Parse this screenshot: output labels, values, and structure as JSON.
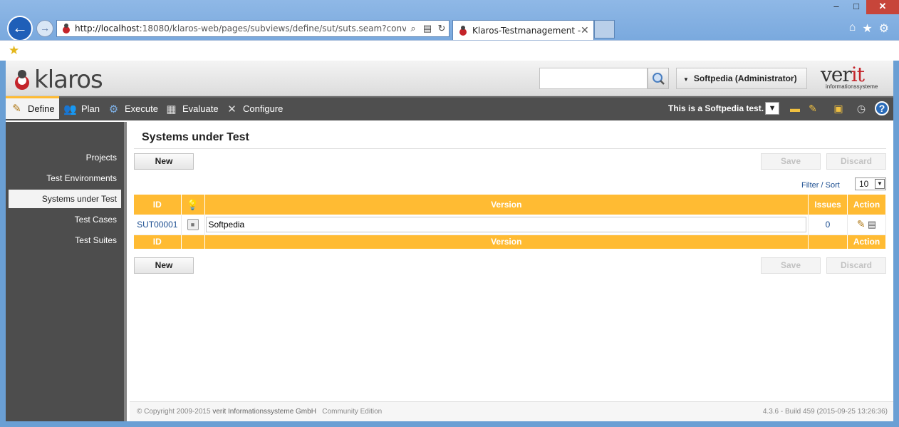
{
  "browser": {
    "url_host": "http://localhost",
    "url_rest": ":18080/klaros-web/pages/subviews/define/sut/suts.seam?conversation",
    "tab_title": "Klaros-Testmanagement - ...",
    "tab_close": "✕"
  },
  "header": {
    "logo_text": "klaros",
    "search_placeholder": "",
    "user_label": "Softpedia (Administrator)",
    "vendor_logo": "verit",
    "vendor_sub": "informationssysteme"
  },
  "nav": {
    "items": [
      {
        "label": "Define",
        "icon": "define-icon"
      },
      {
        "label": "Plan",
        "icon": "plan-icon"
      },
      {
        "label": "Execute",
        "icon": "execute-icon"
      },
      {
        "label": "Evaluate",
        "icon": "evaluate-icon"
      },
      {
        "label": "Configure",
        "icon": "configure-icon"
      }
    ],
    "project": "This is a Softpedia test."
  },
  "sidebar": {
    "items": [
      {
        "label": "Projects"
      },
      {
        "label": "Test Environments"
      },
      {
        "label": "Systems under Test"
      },
      {
        "label": "Test Cases"
      },
      {
        "label": "Test Suites"
      }
    ]
  },
  "main": {
    "title": "Systems under Test",
    "new_label": "New",
    "save_label": "Save",
    "discard_label": "Discard",
    "filter_label": "Filter / Sort",
    "page_size": "10",
    "columns": {
      "id": "ID",
      "version": "Version",
      "issues": "Issues",
      "action": "Action"
    },
    "rows": [
      {
        "id": "SUT00001",
        "version": "Softpedia",
        "issues": "0"
      }
    ]
  },
  "footer": {
    "copyright": "© Copyright 2009-2015",
    "company": "verit Informationssysteme GmbH",
    "edition": "Community Edition",
    "build": "4.3.6 - Build 459 (2015-09-25 13:26:36)"
  },
  "colors": {
    "accent": "#ffbb33",
    "nav_bg": "#4f4f4f",
    "link": "#1d4f91"
  }
}
